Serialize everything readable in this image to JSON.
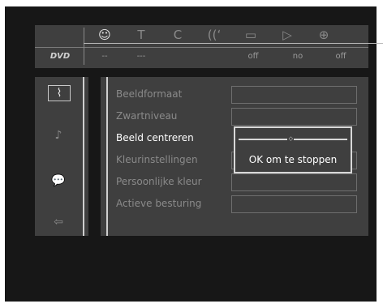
{
  "toolbar": {
    "disc_label": "DVD",
    "icons": [
      {
        "name": "audio-icon",
        "glyph": "☺",
        "active": true
      },
      {
        "name": "title-icon",
        "glyph": "T",
        "active": false
      },
      {
        "name": "chapter-icon",
        "glyph": "C",
        "active": false
      },
      {
        "name": "sound-icon",
        "glyph": "((ʻ",
        "active": false
      },
      {
        "name": "subtitle-icon",
        "glyph": "▭",
        "active": false
      },
      {
        "name": "angle-icon",
        "glyph": "▷",
        "active": false
      },
      {
        "name": "zoom-icon",
        "glyph": "⊕",
        "active": false
      }
    ],
    "values": [
      "--",
      "---",
      "",
      "",
      "off",
      "no",
      "off"
    ]
  },
  "sidebar": {
    "icons": [
      "picture-icon",
      "audio-note-icon",
      "language-icon",
      "features-icon"
    ],
    "glyphs": [
      "⌇",
      "♪",
      "💬",
      "⇦"
    ]
  },
  "menu": {
    "items": [
      {
        "label": "Beeldformaat",
        "active": false
      },
      {
        "label": "Zwartniveau",
        "active": false
      },
      {
        "label": "Beeld centreren",
        "active": true
      },
      {
        "label": "Kleurinstellingen",
        "active": false
      },
      {
        "label": "Persoonlijke kleur",
        "active": false
      },
      {
        "label": "Actieve besturing",
        "active": false
      }
    ]
  },
  "popup": {
    "slider_level": 0.48,
    "knob_glyph": "◇",
    "message": "OK om te stoppen"
  }
}
